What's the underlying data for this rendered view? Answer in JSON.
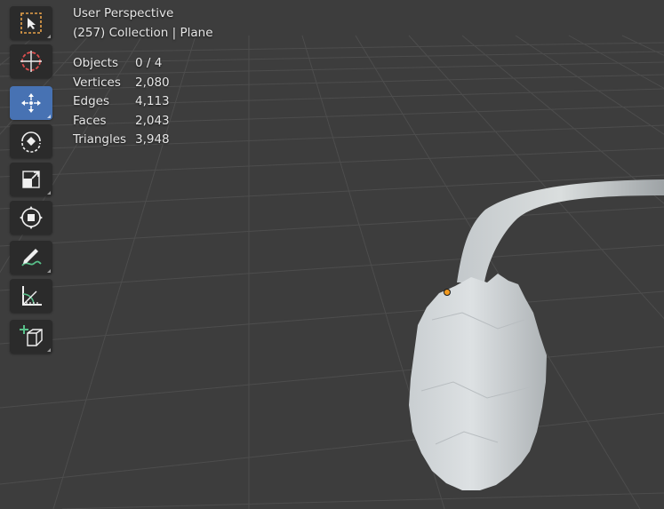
{
  "viewport": {
    "view_name": "User Perspective",
    "collection_info": "(257) Collection | Plane",
    "stats": [
      {
        "label": "Objects",
        "value": "0 / 4"
      },
      {
        "label": "Vertices",
        "value": "2,080"
      },
      {
        "label": "Edges",
        "value": "4,113"
      },
      {
        "label": "Faces",
        "value": "2,043"
      },
      {
        "label": "Triangles",
        "value": "3,948"
      }
    ]
  },
  "toolbar": {
    "tools": [
      {
        "name": "select-box",
        "icon": "select-box-icon",
        "active": false
      },
      {
        "name": "cursor",
        "icon": "cursor-icon",
        "active": false
      },
      {
        "name": "move",
        "icon": "move-icon",
        "active": true
      },
      {
        "name": "rotate",
        "icon": "rotate-icon",
        "active": false
      },
      {
        "name": "scale",
        "icon": "scale-icon",
        "active": false
      },
      {
        "name": "transform",
        "icon": "transform-icon",
        "active": false
      },
      {
        "name": "annotate",
        "icon": "annotate-icon",
        "active": false
      },
      {
        "name": "measure",
        "icon": "measure-icon",
        "active": false
      },
      {
        "name": "add-cube",
        "icon": "add-cube-icon",
        "active": false
      }
    ]
  },
  "colors": {
    "background": "#3d3d3d",
    "grid": "#4c4c4c",
    "tool_bg": "#2b2b2b",
    "active_tool": "#4772b3",
    "object": "#d2d6d8",
    "origin": "#f39a1f"
  }
}
